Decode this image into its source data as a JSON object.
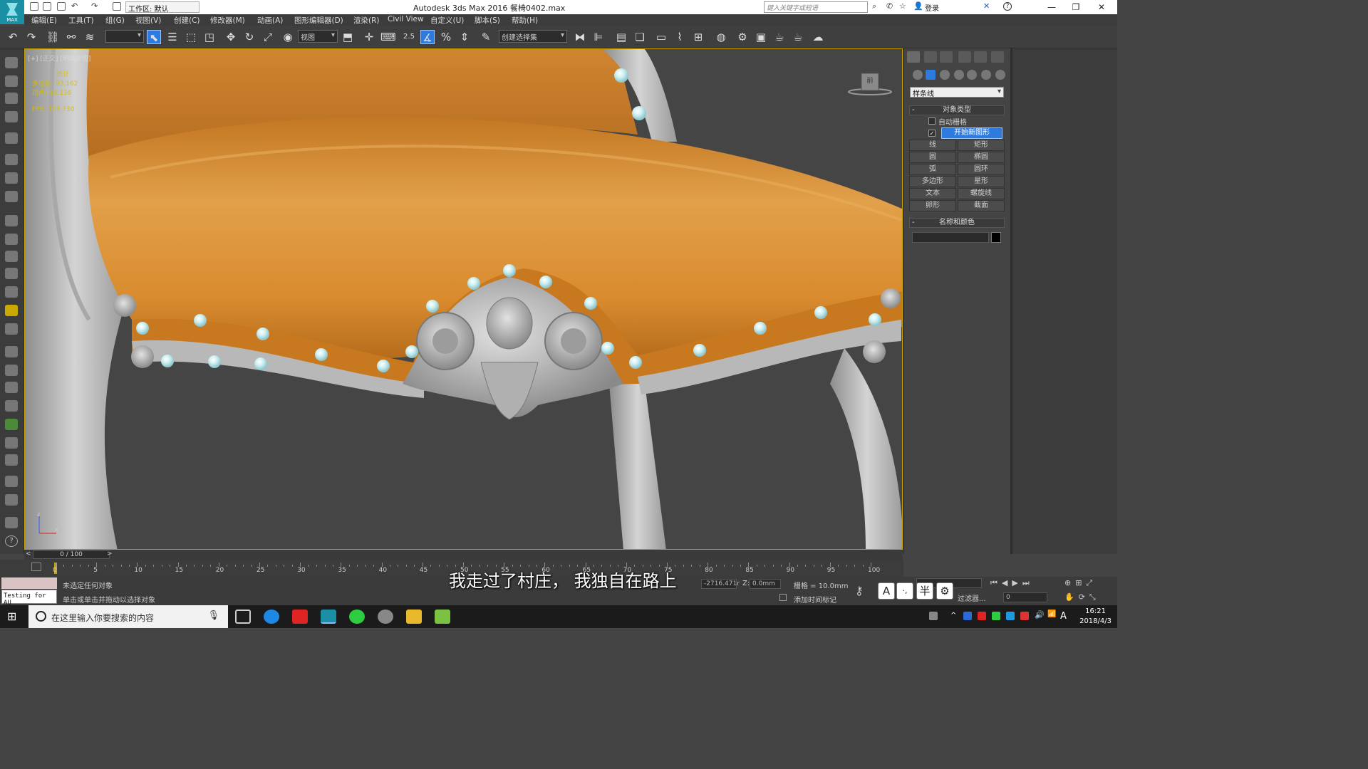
{
  "titlebar": {
    "workspace": "工作区: 默认",
    "title": "Autodesk 3ds Max 2016      餐椅0402.max",
    "search_placeholder": "键入关键字或短语",
    "login": "登录"
  },
  "logo": {
    "label": "MAX"
  },
  "menu": [
    "编辑(E)",
    "工具(T)",
    "组(G)",
    "视图(V)",
    "创建(C)",
    "修改器(M)",
    "动画(A)",
    "图形编辑器(D)",
    "渲染(R)",
    "Civil View",
    "自定义(U)",
    "脚本(S)",
    "帮助(H)"
  ],
  "toolbar": {
    "ref_coord": "视图",
    "snap_value": "2.5",
    "selection_set": "创建选择集"
  },
  "viewport": {
    "label": "[+] [正交] [明暗处理]",
    "stats": [
      "总计",
      "多边形:  93,162",
      "顶点:    49,136",
      "",
      "FPS:    103.730"
    ],
    "viewcube_label": "前"
  },
  "command_panel": {
    "category": "样条线",
    "object_type_title": "对象类型",
    "autogrid_label": "自动栅格",
    "start_new_shape": "开始新图形",
    "buttons": [
      "线",
      "矩形",
      "圆",
      "椭圆",
      "弧",
      "圆环",
      "多边形",
      "星形",
      "文本",
      "螺旋线",
      "卵形",
      "截面"
    ],
    "name_color_title": "名称和颜色"
  },
  "timeline": {
    "frame_range": "0 / 100",
    "ticks": [
      "0",
      "5",
      "10",
      "15",
      "20",
      "25",
      "30",
      "35",
      "40",
      "45",
      "50",
      "55",
      "60",
      "65",
      "70",
      "75",
      "80",
      "85",
      "90",
      "95",
      "100"
    ]
  },
  "status": {
    "selection": "未选定任何对象",
    "prompt": "单击或单击并拖动以选择对象",
    "testing": "Testing for AU",
    "y_value": "-2716.471r",
    "z_label": "Z:",
    "z_value": "0.0mm",
    "grid": "栅格 = 10.0mm",
    "add_time_tag": "添加时间标记",
    "filter": "过滤器...",
    "frame_field": "0"
  },
  "subtitle": "我走过了村庄，   我独自在路上",
  "ime": [
    "A",
    "·,",
    "半",
    "⚙"
  ],
  "taskbar": {
    "search_placeholder": "在这里输入你要搜索的内容",
    "time": "16:21",
    "date": "2018/4/3",
    "ime_label": "A"
  },
  "colors": {
    "leather": "#d88a2e",
    "frame": "#bdbdbd",
    "rivet": "#cdeff2",
    "viewport_bg": "#454545",
    "active_blue": "#2e7be0"
  }
}
